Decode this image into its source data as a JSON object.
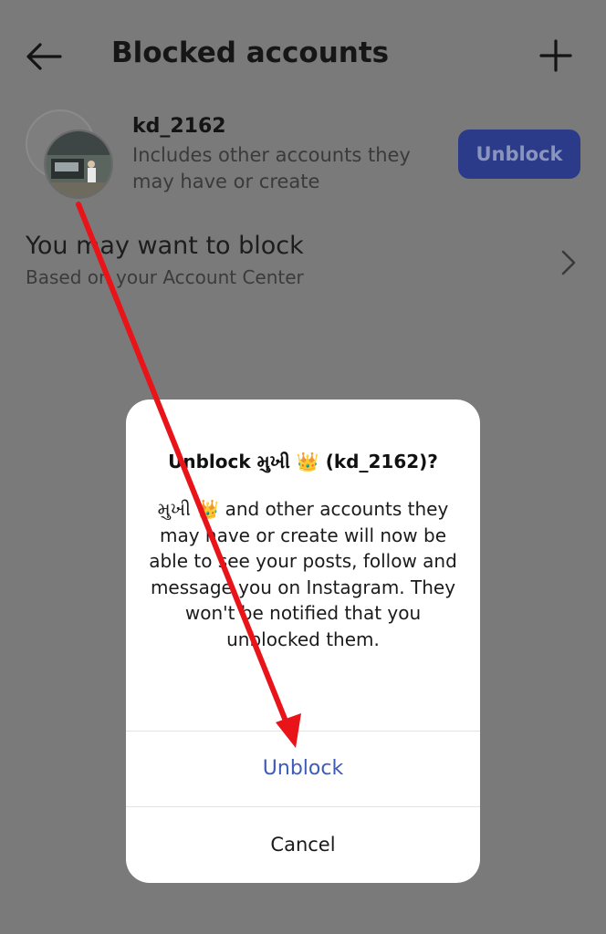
{
  "header": {
    "title": "Blocked accounts",
    "back_icon": "arrow-left-icon",
    "add_icon": "plus-icon"
  },
  "blocked_account": {
    "username": "kd_2162",
    "subtitle": "Includes other accounts they may have or create",
    "unblock_label": "Unblock",
    "button_color": "#2c3a8a"
  },
  "suggestion": {
    "title": "You may want to block",
    "subtitle": "Based on your Account Center",
    "chevron_icon": "chevron-right-icon"
  },
  "dialog": {
    "title_prefix": "Unblock મુખી ",
    "title_crown": "👑",
    "title_suffix": " (kd_2162)?",
    "body_prefix": "મુખી ",
    "body_crown": "👑",
    "body_text": " and other accounts they may have or create will now be able to see your posts, follow and message you on Instagram. They won't be notified that you unblocked them.",
    "confirm_label": "Unblock",
    "cancel_label": "Cancel",
    "confirm_color": "#3f5bb8"
  },
  "annotation": {
    "arrow_color": "#e8141a",
    "arrow_icon": "red-arrow-annotation"
  }
}
